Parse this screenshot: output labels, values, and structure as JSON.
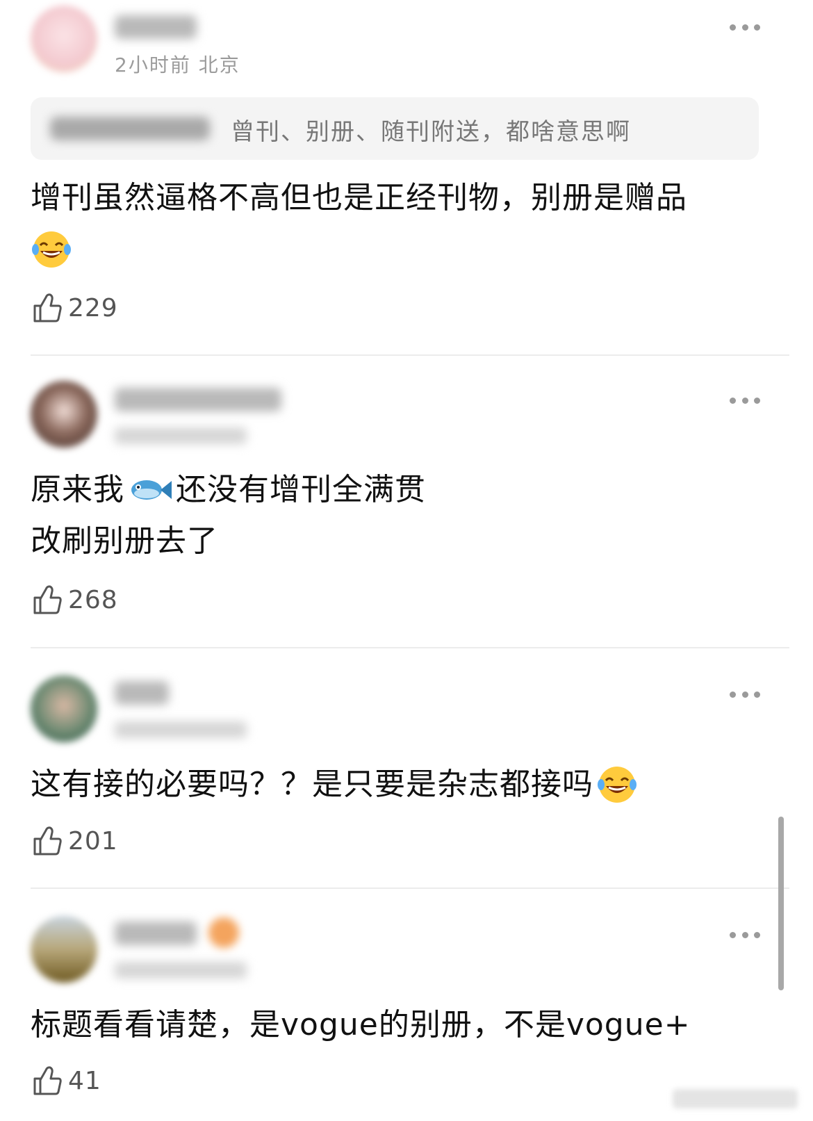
{
  "comments": [
    {
      "meta": "2小时前 北京",
      "quote_text": "曾刊、别册、随刊附送，都啥意思啊",
      "lines": [
        "增刊虽然逼格不高但也是正经刊物，别册是赠品"
      ],
      "likes": "229",
      "avatar_color": "#f4cfd4"
    },
    {
      "lines": [
        "原来我",
        "还没有增刊全满贯",
        "改刷别册去了"
      ],
      "likes": "268",
      "avatar_color": "#5a4038"
    },
    {
      "lines": [
        "这有接的必要吗？？是只要是杂志都接吗"
      ],
      "likes": "201",
      "avatar_color": "#3f6a58"
    },
    {
      "lines": [
        "标题看看请楚，是vogue的别册，不是vogue+"
      ],
      "likes": "41",
      "avatar_color": "#8f7a3a"
    }
  ],
  "icons": {
    "more": "more-dots-icon",
    "like": "thumbs-up-icon",
    "emoji_laugh": "laughing-tears-emoji",
    "emoji_fish": "fish-emoji"
  },
  "colors": {
    "text": "#111111",
    "meta": "#9b9b9b",
    "quote_bg": "#f4f4f4",
    "divider": "#ececec"
  }
}
